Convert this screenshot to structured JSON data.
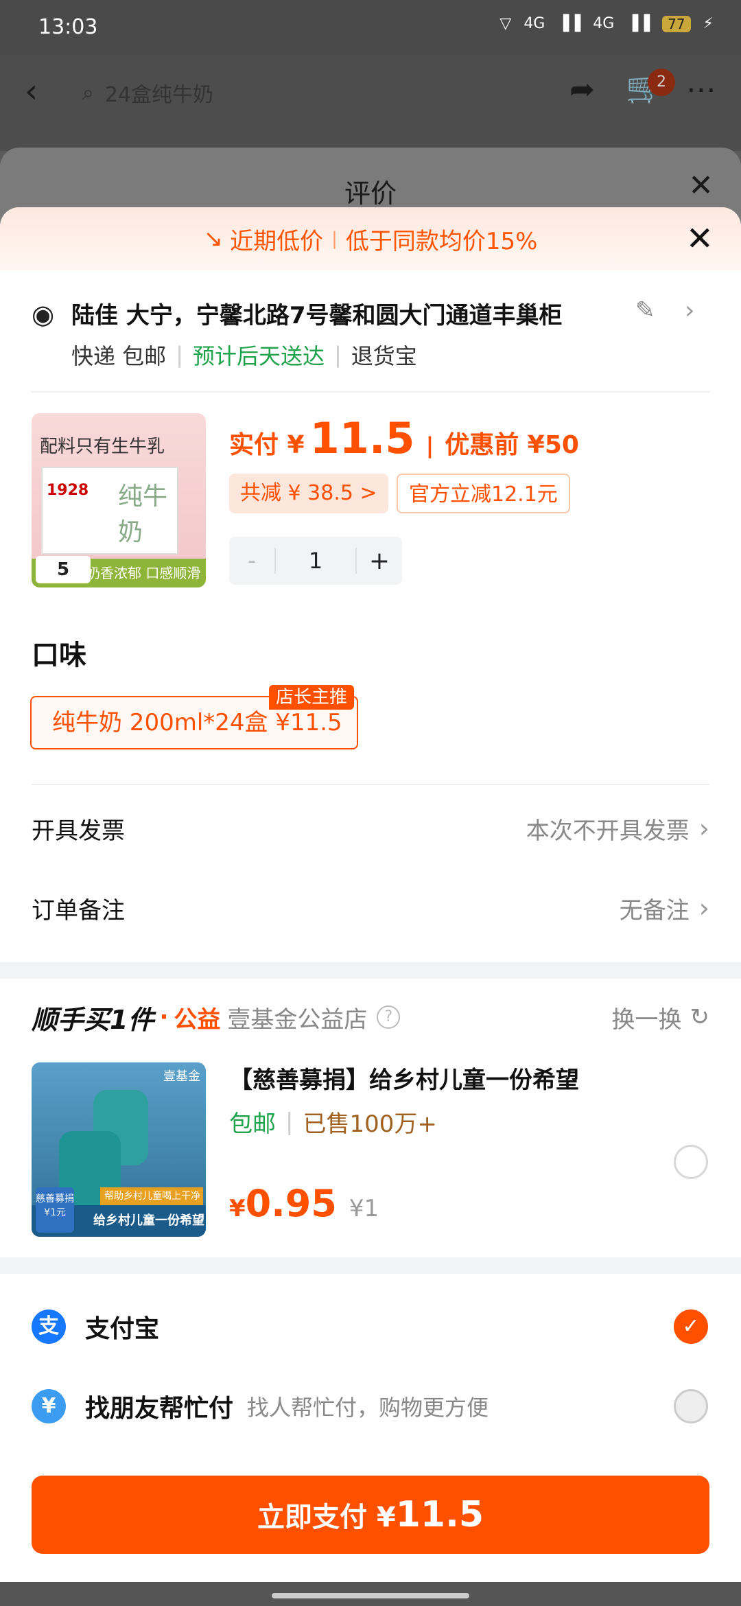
{
  "status_bar": {
    "time": "13:03",
    "network1": "4G",
    "network2": "4G",
    "battery": "77"
  },
  "background_page": {
    "search_text": "24盒纯牛奶",
    "cart_count": "2"
  },
  "review_sheet": {
    "title": "评价"
  },
  "banner": {
    "tag1": "近期低价",
    "tag2": "低于同款均价15%"
  },
  "address": {
    "line": "陆佳 大宁，宁馨北路7号馨和圆大门通道丰巢柜",
    "shipping": "快递 包邮",
    "delivery": "预计后天送达",
    "return": "退货宝"
  },
  "product": {
    "image_headline": "配料只有生牛乳",
    "image_brand": "1928",
    "image_name": "纯牛奶",
    "image_footer": "奶香浓郁 口感顺滑",
    "image_coupon": "5",
    "price_label": "实付 ¥",
    "price": "11.5",
    "before_label": "优惠前 ¥50",
    "saving_tag": "共减 ¥ 38.5 >",
    "official_tag": "官方立减12.1元",
    "qty_minus": "-",
    "qty": "1",
    "qty_plus": "+"
  },
  "flavor": {
    "title": "口味",
    "option": "纯牛奶 200ml*24盒  ¥11.5",
    "option_tag": "店长主推"
  },
  "invoice": {
    "label": "开具发票",
    "value": "本次不开具发票"
  },
  "note": {
    "label": "订单备注",
    "value": "无备注"
  },
  "charity": {
    "brand": "顺手买1件",
    "dot": "·",
    "gongyi": "公益",
    "shop": "壹基金公益店",
    "swap": "换一换",
    "image_fund": "壹基金",
    "image_caption": "帮助乡村儿童喝上干净的水",
    "image_footer": "给乡村儿童一份希望",
    "image_badge": "慈善募捐 ¥1元",
    "title": "【慈善募捐】给乡村儿童一份希望",
    "shipping": "包邮",
    "sold": "已售100万+",
    "price_cur": "¥",
    "price": "0.95",
    "orig_price": "¥1"
  },
  "payment": {
    "alipay": "支付宝",
    "friend": "找朋友帮忙付",
    "friend_desc": "找人帮忙付，购物更方便"
  },
  "pay_button": {
    "label": "立即支付 ¥",
    "amount": "11.5"
  }
}
